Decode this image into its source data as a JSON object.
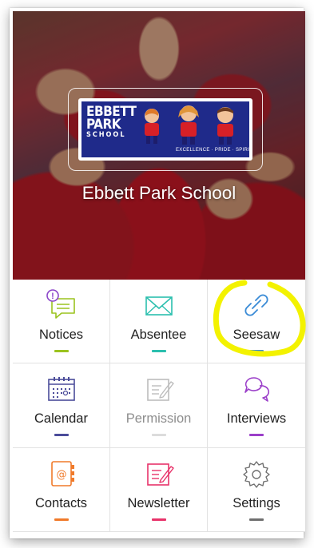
{
  "school": {
    "name": "Ebbett Park School",
    "logo_line1": "EBBETT",
    "logo_line2": "PARK",
    "logo_line3": "SCHOOL",
    "logo_tagline": "EXCELLENCE · PRIDE · SPIRIT"
  },
  "tiles": [
    {
      "label": "Notices",
      "icon": "notices-icon",
      "color": "#9bc31f",
      "badge": "!"
    },
    {
      "label": "Absentee",
      "icon": "envelope-icon",
      "color": "#2bbfae"
    },
    {
      "label": "Seesaw",
      "icon": "link-icon",
      "color": "#3a8bd6"
    },
    {
      "label": "Calendar",
      "icon": "calendar-icon",
      "color": "#4b4c9a"
    },
    {
      "label": "Permission",
      "icon": "permission-icon",
      "color": "#bdbdbd"
    },
    {
      "label": "Interviews",
      "icon": "chat-bubbles-icon",
      "color": "#9b3fc9"
    },
    {
      "label": "Contacts",
      "icon": "address-book-icon",
      "color": "#f07a2a"
    },
    {
      "label": "Newsletter",
      "icon": "newsletter-icon",
      "color": "#e8336a"
    },
    {
      "label": "Settings",
      "icon": "gear-icon",
      "color": "#6f6f6f"
    }
  ],
  "annotation_color": "#f3f200"
}
